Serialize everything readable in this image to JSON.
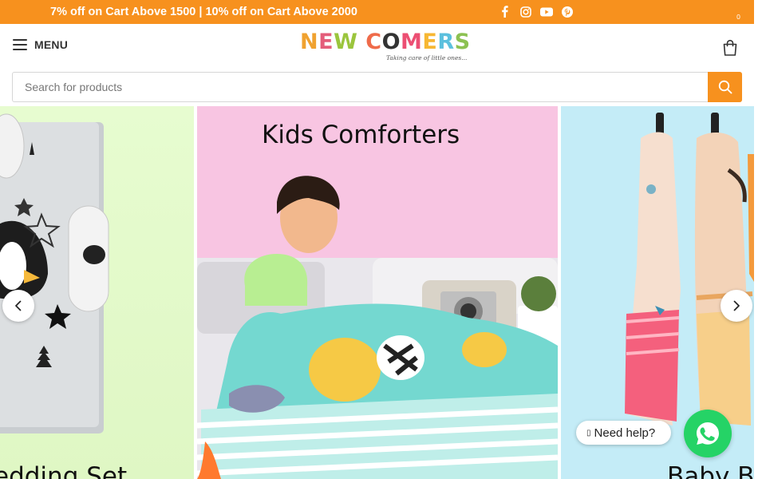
{
  "promo_bar": {
    "text": "7% off on Cart Above 1500 | 10% off on Cart Above 2000",
    "background": "#f7911e",
    "socials": [
      {
        "icon": "facebook-icon"
      },
      {
        "icon": "instagram-icon"
      },
      {
        "icon": "youtube-icon"
      },
      {
        "icon": "pinterest-icon"
      }
    ]
  },
  "header": {
    "menu_label": "MENU",
    "logo": {
      "letters": [
        "N",
        "E",
        "W",
        " ",
        "C",
        "O",
        "M",
        "E",
        "R",
        "S"
      ],
      "letter_colors": [
        "#f0a230",
        "#e45d7a",
        "#9bc53d",
        "",
        "#ef6b4a",
        "#333333",
        "#ec4f73",
        "#f7b733",
        "#5bc0de",
        "#8cc152"
      ],
      "tagline": "Taking care of little ones..."
    },
    "cart_count": "0"
  },
  "search": {
    "placeholder": "Search for products",
    "value": ""
  },
  "slider": {
    "slides": [
      {
        "title": "Bedding Set",
        "visible_title": "edding Set"
      },
      {
        "title": "Kids Comforters"
      },
      {
        "title": "Baby B",
        "visible_title": "Baby B"
      }
    ]
  },
  "whatsapp": {
    "help_text": "Need help?",
    "glyph": "▯"
  },
  "colors": {
    "accent": "#f7911e",
    "whatsapp": "#25d366"
  }
}
